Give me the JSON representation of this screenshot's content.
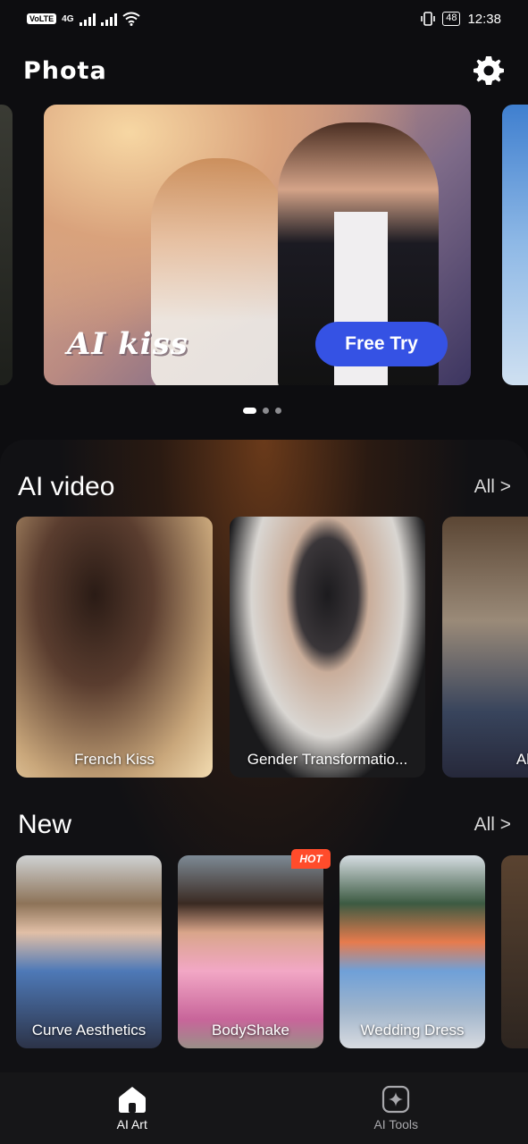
{
  "status_bar": {
    "network_tag": "VoLTE",
    "network_type": "4G",
    "battery": "48",
    "time": "12:38"
  },
  "header": {
    "title": "Phota",
    "settings_icon": "gear-icon"
  },
  "hero": {
    "label": "AI kiss",
    "cta": "Free Try",
    "page_index": 1,
    "page_count": 3
  },
  "ai_video": {
    "title": "AI video",
    "all_label": "All >",
    "items": [
      {
        "label": "French Kiss"
      },
      {
        "label": "Gender Transformatio..."
      },
      {
        "label": "Al"
      }
    ]
  },
  "new_section": {
    "title": "New",
    "all_label": "All >",
    "items": [
      {
        "label": "Curve Aesthetics"
      },
      {
        "label": "BodyShake",
        "badge": "HOT"
      },
      {
        "label": "Wedding Dress"
      }
    ]
  },
  "bottom_nav": {
    "items": [
      {
        "label": "AI Art",
        "icon": "home-icon",
        "active": true
      },
      {
        "label": "AI Tools",
        "icon": "sparkle-icon",
        "active": false
      }
    ]
  },
  "colors": {
    "accent": "#3552e4",
    "hot": "#ff4c2b",
    "background": "#0d0d10"
  }
}
